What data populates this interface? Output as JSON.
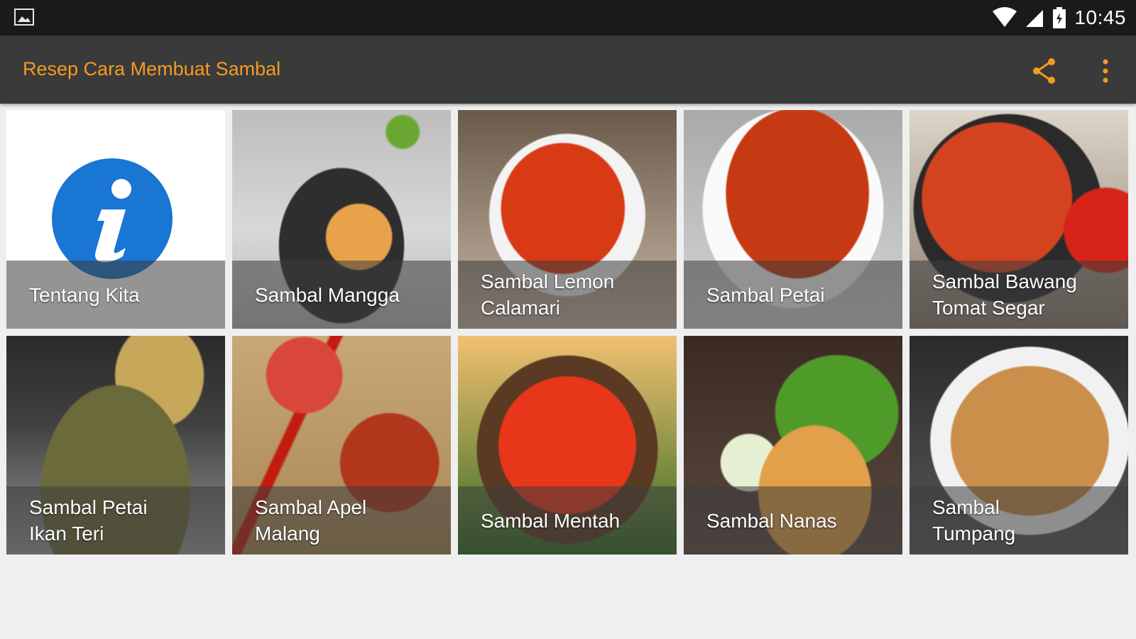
{
  "status_bar": {
    "time": "10:45",
    "left_icon": "image-notification-icon",
    "right_icons": [
      "wifi-icon",
      "signal-icon",
      "battery-icon"
    ]
  },
  "app_bar": {
    "title": "Resep Cara Membuat Sambal",
    "actions": [
      "share-icon",
      "overflow-menu-icon"
    ],
    "accent_color": "#f59a22"
  },
  "grid": {
    "items": [
      {
        "label": "Tentang Kita",
        "icon": "info-icon"
      },
      {
        "label": "Sambal Mangga"
      },
      {
        "label": "Sambal Lemon\nCalamari"
      },
      {
        "label": "Sambal Petai"
      },
      {
        "label": "Sambal Bawang\nTomat Segar"
      },
      {
        "label": "Sambal Petai\nIkan Teri"
      },
      {
        "label": "Sambal Apel\nMalang"
      },
      {
        "label": "Sambal Mentah"
      },
      {
        "label": "Sambal Nanas"
      },
      {
        "label": "Sambal\nTumpang"
      }
    ]
  }
}
